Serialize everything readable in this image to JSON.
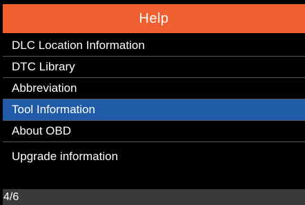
{
  "header": {
    "title": "Help"
  },
  "menu": {
    "selected_index": 3,
    "items": [
      {
        "label": "DLC Location Information"
      },
      {
        "label": "DTC Library"
      },
      {
        "label": "Abbreviation"
      },
      {
        "label": "Tool Information"
      },
      {
        "label": "About OBD"
      },
      {
        "label": "Upgrade information"
      }
    ]
  },
  "status": {
    "page_indicator": "4/6"
  },
  "colors": {
    "title_bar": "#ef5f2f",
    "selection": "#1f5ba6",
    "background": "#000000",
    "status_bar": "#3a3a3a"
  }
}
